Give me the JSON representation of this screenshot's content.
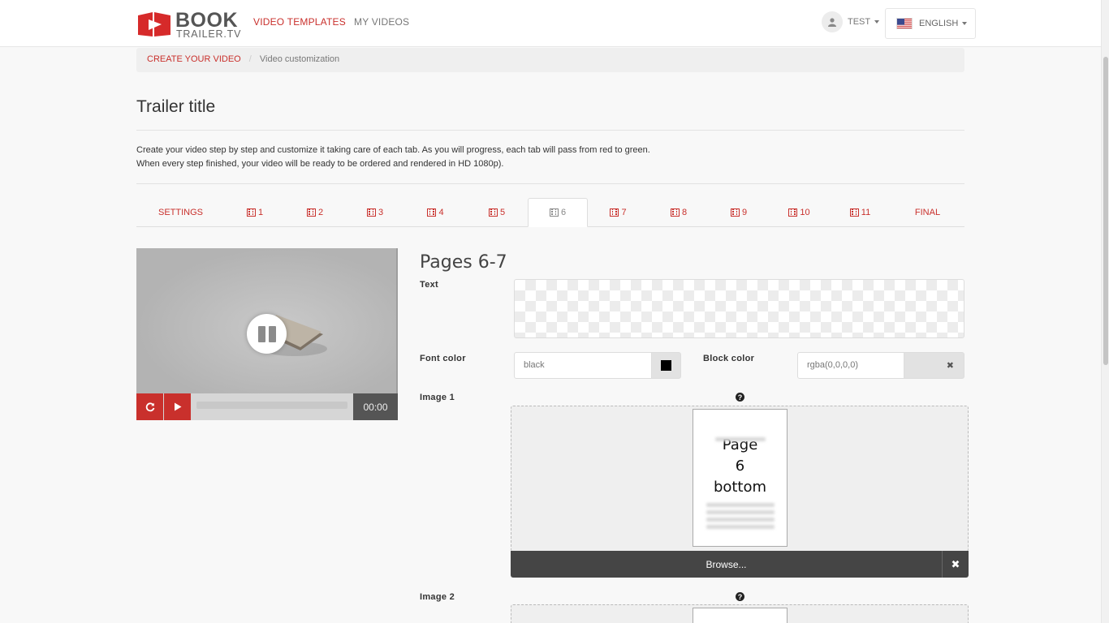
{
  "header": {
    "logo_text_main": "BOOK",
    "logo_text_sub": "TRAILER.TV",
    "nav": [
      {
        "label": "VIDEO TEMPLATES",
        "active": true
      },
      {
        "label": "MY VIDEOS",
        "active": false
      }
    ],
    "user_label": "TEST",
    "language_label": "ENGLISH",
    "accent_color": "#c9302c"
  },
  "breadcrumb": {
    "link_label": "CREATE YOUR VIDEO",
    "separator": "/",
    "current": "Video customization"
  },
  "page": {
    "title": "Trailer title",
    "intro_line1": "Create your video step by step and customize it taking care of each tab. As you will progress, each tab will pass from red to green.",
    "intro_line2": "When every step finished, your video will be ready to be ordered and rendered in HD 1080p)."
  },
  "tabs": [
    {
      "label": "SETTINGS",
      "icon": null
    },
    {
      "label": "1",
      "icon": "film-icon"
    },
    {
      "label": "2",
      "icon": "film-icon"
    },
    {
      "label": "3",
      "icon": "film-icon"
    },
    {
      "label": "4",
      "icon": "film-icon"
    },
    {
      "label": "5",
      "icon": "film-icon"
    },
    {
      "label": "6",
      "icon": "film-icon",
      "active": true
    },
    {
      "label": "7",
      "icon": "film-icon"
    },
    {
      "label": "8",
      "icon": "film-icon"
    },
    {
      "label": "9",
      "icon": "film-icon"
    },
    {
      "label": "10",
      "icon": "film-icon"
    },
    {
      "label": "11",
      "icon": "film-icon"
    },
    {
      "label": "FINAL",
      "icon": null
    }
  ],
  "player": {
    "time": "00:00",
    "state": "paused-overlay"
  },
  "form": {
    "section_title": "Pages 6-7",
    "text_label": "Text",
    "font_color_label": "Font color",
    "font_color_value": "black",
    "block_color_label": "Block color",
    "block_color_value": "rgba(0,0,0,0)",
    "image1_label": "Image 1",
    "image1_thumb_text": [
      "Page",
      "6",
      "bottom"
    ],
    "browse_label": "Browse...",
    "image2_label": "Image 2",
    "help_glyph": "?",
    "clear_glyph": "✖"
  }
}
